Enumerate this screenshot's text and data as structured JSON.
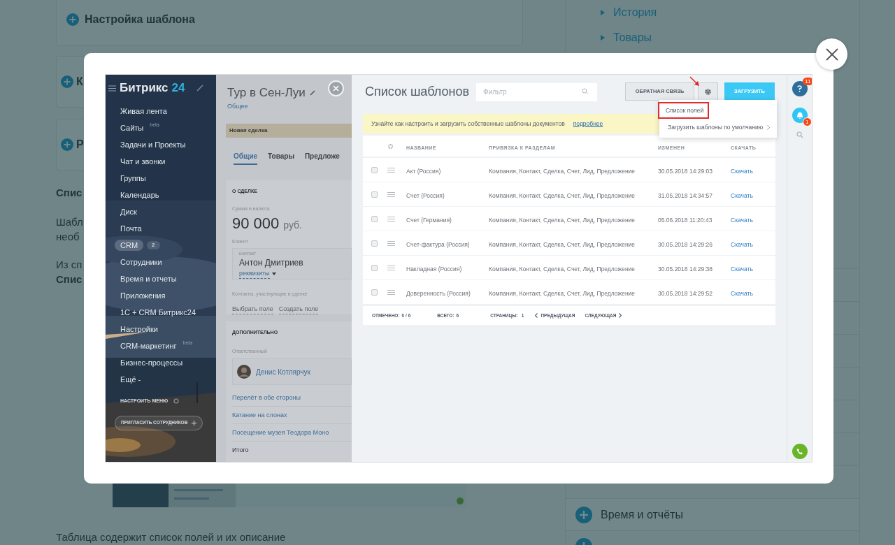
{
  "background_page": {
    "left_cards": [
      {
        "title": "Настройка шаблона"
      },
      {
        "title": "К"
      },
      {
        "title": "Р"
      }
    ],
    "text_fragments": [
      {
        "text": "Спис",
        "bold": true
      },
      {
        "text": "Шабл",
        "bold": false
      },
      {
        "text": "необ",
        "bold": false
      },
      {
        "text": "Из сп",
        "bold": false
      },
      {
        "text": "Спис",
        "bold": true
      }
    ],
    "bottom_text": "Таблица содержит список полей и их описание",
    "right_links": [
      "История",
      "Товары"
    ],
    "right_sections": [
      "Время и отчёты"
    ]
  },
  "lightbox": {
    "sidebar": {
      "logo_text": "Битрикс",
      "logo_number": "24",
      "items": [
        {
          "label": "Живая лента",
          "selected": false
        },
        {
          "label": "Сайты",
          "badge": "beta",
          "selected": false
        },
        {
          "label": "Задачи и Проекты",
          "selected": false
        },
        {
          "label": "Чат и звонки",
          "selected": false
        },
        {
          "label": "Группы",
          "selected": false
        },
        {
          "label": "Календарь",
          "selected": false
        },
        {
          "label": "Диск",
          "selected": false
        },
        {
          "label": "Почта",
          "selected": false
        },
        {
          "label": "CRM",
          "counter": "2",
          "selected": true
        },
        {
          "label": "Сотрудники",
          "selected": false
        },
        {
          "label": "Время и отчеты",
          "selected": false
        },
        {
          "label": "Приложения",
          "selected": false
        },
        {
          "label": "1С + CRM Битрикс24",
          "selected": false
        },
        {
          "label": "Настройки",
          "selected": false
        },
        {
          "label": "CRM-маркетинг",
          "badge": "beta",
          "selected": false
        },
        {
          "label": "Бизнес-процессы",
          "selected": false
        },
        {
          "label": "Ещё -",
          "selected": false
        }
      ],
      "settings_label": "НАСТРОИТЬ МЕНЮ",
      "invite_button": "ПРИГЛАСИТЬ СОТРУДНИКОВ"
    },
    "deal": {
      "title": "Тур в Сен-Луи",
      "subtitle": "Общее",
      "stage": "Новая сделка",
      "tabs": [
        {
          "label": "Общие",
          "selected": true
        },
        {
          "label": "Товары",
          "selected": false
        },
        {
          "label": "Предложе",
          "selected": false
        }
      ],
      "section_title": "О СДЕЛКЕ",
      "amount_label": "Сумма и валюта",
      "amount": "90 000",
      "currency": "руб.",
      "client_label": "Клиент",
      "contact_caption": "контакт",
      "contact_name": "Антон Дмитриев",
      "requisites": "реквизиты",
      "participants_label": "Контакты, участвующие в сделке",
      "field_actions": [
        "Выбрать поле",
        "Создать поле"
      ],
      "extra_title": "ДОПОЛНИТЕЛЬНО",
      "responsible_label": "Ответственный",
      "responsible_name": "Денис Котлярчук",
      "products": [
        "Перелёт в обе стороны",
        "Катание на слонах",
        "Посещение музея Теодора Моно"
      ],
      "total_label": "Итого"
    },
    "main": {
      "title": "Список шаблонов",
      "filter_placeholder": "Фильтр",
      "feedback_button": "ОБРАТНАЯ СВЯЗЬ",
      "upload_button": "ЗАГРУЗИТЬ",
      "menu": [
        {
          "label": "Список полей",
          "highlighted": true,
          "submenu": false
        },
        {
          "label": "Загрузить шаблоны по умолчанию",
          "highlighted": false,
          "submenu": true
        }
      ],
      "notice": "Узнайте как настроить и загрузить собственные шаблоны документов",
      "notice_link": "подробнее",
      "table": {
        "columns": [
          "НАЗВАНИЕ",
          "ПРИВЯЗКА К РАЗДЕЛАМ",
          "ИЗМЕНЕН",
          "СКАЧАТЬ"
        ],
        "rows": [
          {
            "name": "Акт (Россия)",
            "sections": "Компания, Контакт, Сделка, Счет, Лид, Предложение",
            "modified": "30.05.2018 14:29:03",
            "download": "Скачать",
            "checked": false
          },
          {
            "name": "Счет (Россия)",
            "sections": "Компания, Контакт, Сделка, Счет, Лид, Предложение",
            "modified": "31.05.2018 14:34:57",
            "download": "Скачать",
            "checked": false
          },
          {
            "name": "Счет (Германия)",
            "sections": "Компания, Контакт, Сделка, Счет, Лид, Предложение",
            "modified": "05.06.2018 11:20:43",
            "download": "Скачать",
            "checked": false
          },
          {
            "name": "Счет-фактура (Россия)",
            "sections": "Компания, Контакт, Сделка, Счет, Лид, Предложение",
            "modified": "30.05.2018 14:29:26",
            "download": "Скачать",
            "checked": false
          },
          {
            "name": "Накладная (Россия)",
            "sections": "Компания, Контакт, Сделка, Счет, Лид, Предложение",
            "modified": "30.05.2018 14:29:38",
            "download": "Скачать",
            "checked": false
          },
          {
            "name": "Доверенность (Россия)",
            "sections": "Компания, Контакт, Сделка, Счет, Лид, Предложение",
            "modified": "30.05.2018 14:29:52",
            "download": "Скачать",
            "checked": false
          }
        ]
      },
      "footer": {
        "checked_label": "ОТМЕЧЕНО:",
        "checked_value": "0 / 6",
        "total_label": "ВСЕГО:",
        "total_value": "6",
        "pages_label": "СТРАНИЦЫ:",
        "pages_value": "1",
        "prev": "ПРЕДЫДУЩАЯ",
        "next": "СЛЕДУЮЩАЯ"
      }
    },
    "right_bar": {
      "help_count": "11",
      "notifications_count": "1"
    }
  }
}
